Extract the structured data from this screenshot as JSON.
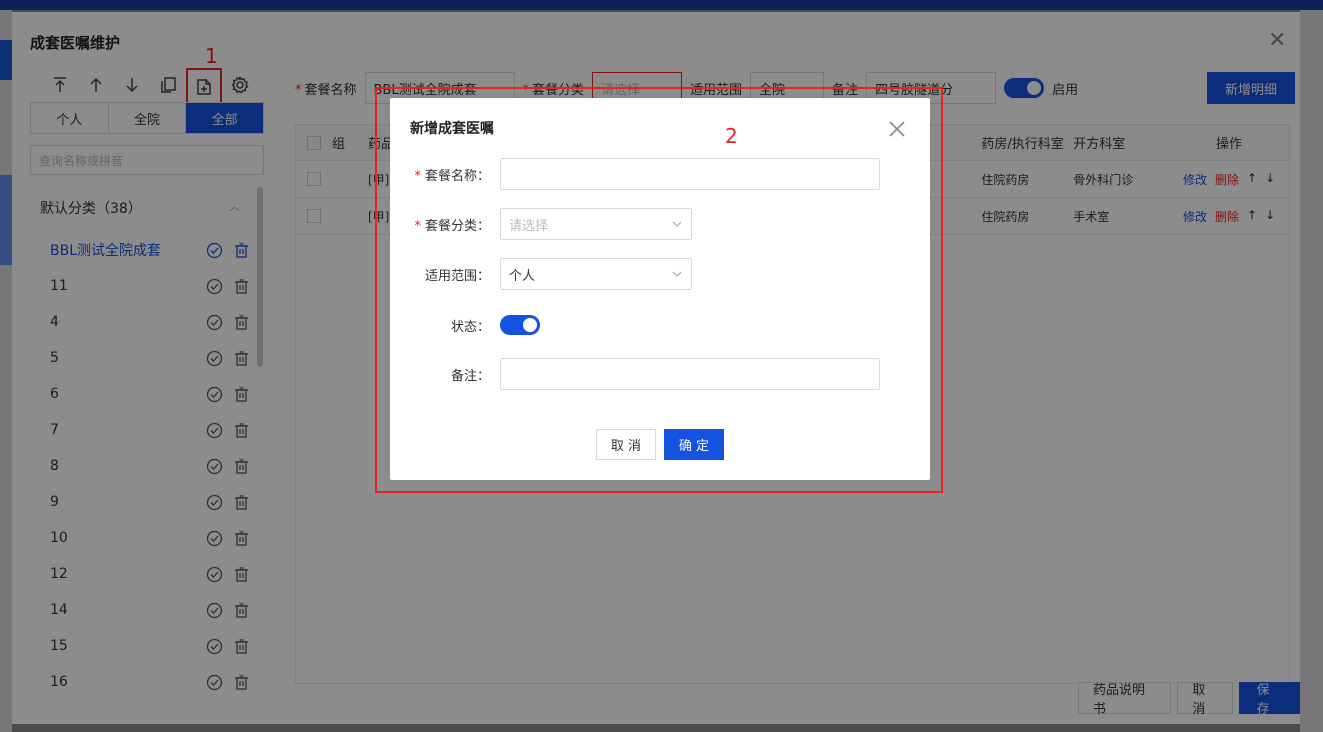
{
  "window": {
    "title": "成套医嘱维护"
  },
  "annotations": {
    "one": "1",
    "two": "2"
  },
  "left": {
    "scope_tabs": [
      "个人",
      "全院",
      "全部"
    ],
    "search_placeholder": "查询名称或拼音",
    "category": {
      "name": "默认分类",
      "count": "（38）"
    },
    "items": [
      "BBL测试全院成套",
      "11",
      "4",
      "5",
      "6",
      "7",
      "8",
      "9",
      "10",
      "12",
      "14",
      "15",
      "16"
    ]
  },
  "filter": {
    "name_label": "套餐名称",
    "name_value": "BBL测试全院成套",
    "category_label": "套餐分类",
    "category_value": "请选择",
    "scope_label": "适用范围",
    "scope_value": "全院",
    "remark_label": "备注",
    "remark_value": "四号胶隧道分",
    "enable_label": "启用",
    "add_button": "新增明细"
  },
  "table": {
    "headers": {
      "group": "组",
      "name": "药品",
      "dept": "药房/执行科室",
      "pres_dept": "开方科室",
      "op": "操作"
    },
    "rows": [
      {
        "name": "[甲]",
        "dept": "住院药房",
        "pres_dept": "骨外科门诊",
        "edit": "修改",
        "del": "删除"
      },
      {
        "name": "[甲]",
        "dept": "住院药房",
        "pres_dept": "手术室",
        "edit": "修改",
        "del": "删除"
      }
    ]
  },
  "footer": {
    "manual": "药品说明书",
    "cancel": "取消",
    "save": "保存"
  },
  "modal": {
    "title": "新增成套医嘱",
    "name_label": "套餐名称：",
    "name_value": "",
    "category_label": "套餐分类：",
    "category_placeholder": "请选择",
    "scope_label": "适用范围：",
    "scope_value": "个人",
    "status_label": "状态：",
    "remark_label": "备注：",
    "remark_value": "",
    "cancel": "取 消",
    "ok": "确 定"
  },
  "colors": {
    "primary": "#1452e0",
    "danger": "#e8231c"
  }
}
